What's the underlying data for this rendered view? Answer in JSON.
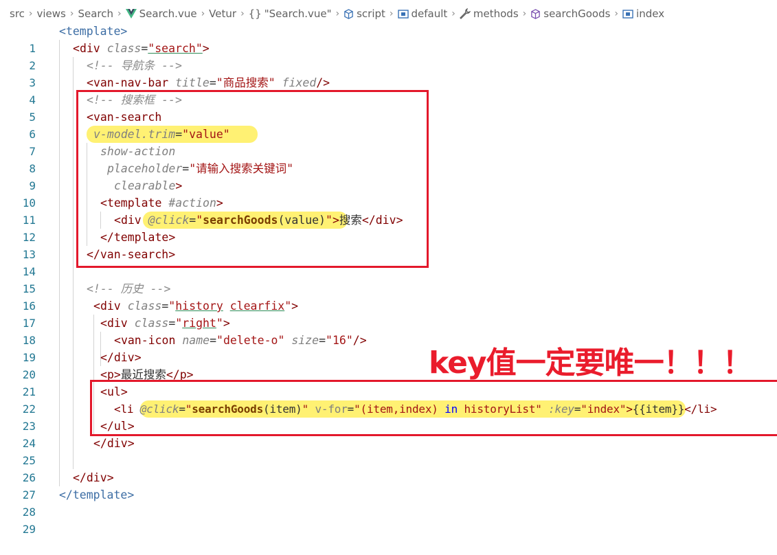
{
  "breadcrumb": [
    {
      "label": "src",
      "icon": ""
    },
    {
      "label": "views",
      "icon": ""
    },
    {
      "label": "Search",
      "icon": ""
    },
    {
      "label": "Search.vue",
      "icon": "vue-logo-icon"
    },
    {
      "label": "Vetur",
      "icon": ""
    },
    {
      "label": "\"Search.vue\"",
      "icon": "braces-icon"
    },
    {
      "label": "script",
      "icon": "cube-icon"
    },
    {
      "label": "default",
      "icon": "variable-icon"
    },
    {
      "label": "methods",
      "icon": "wrench-icon"
    },
    {
      "label": "searchGoods",
      "icon": "cube-icon"
    },
    {
      "label": "index",
      "icon": "variable-icon"
    }
  ],
  "line_numbers": [
    "1",
    "2",
    "3",
    "4",
    "5",
    "6",
    "7",
    "8",
    "9",
    "10",
    "11",
    "12",
    "13",
    "14",
    "15",
    "16",
    "17",
    "18",
    "19",
    "20",
    "21",
    "22",
    "23",
    "24",
    "25",
    "26",
    "27",
    "28",
    "29"
  ],
  "code": {
    "l1": {
      "open": "<",
      "tag": "template",
      "close": ">"
    },
    "l2": {
      "open": "<",
      "tag": "div",
      "attr": "class",
      "eq": "=",
      "val": "\"search\"",
      "close": ">"
    },
    "l3": {
      "comment": "<!-- 导航条 -->"
    },
    "l4": {
      "open": "<",
      "tag": "van-nav-bar",
      "attr": "title",
      "eq": "=",
      "val": "\"商品搜索\"",
      "attr2": "fixed",
      "close": "/>"
    },
    "l5": {
      "comment": "<!-- 搜索框 -->"
    },
    "l6": {
      "open": "<",
      "tag": "van-search"
    },
    "l7": {
      "attr": "v-model.trim",
      "eq": "=",
      "val": "\"value\""
    },
    "l8": {
      "attr": "show-action"
    },
    "l9": {
      "attr": "placeholder",
      "eq": "=",
      "val": "\"请输入搜索关键词\""
    },
    "l10": {
      "attr": "clearable",
      "close": ">"
    },
    "l11": {
      "open": "<",
      "tag": "template",
      "attr": "#action",
      "close": ">"
    },
    "l12": {
      "open": "<",
      "tag": "div",
      "attr": "@click",
      "eq": "=",
      "q1": "\"",
      "fn": "searchGoods",
      "args": "(value)",
      "q2": "\"",
      "close": ">",
      "text": "搜索",
      "endopen": "</",
      "endtag": "div",
      "endclose": ">"
    },
    "l13": {
      "open": "</",
      "tag": "template",
      "close": ">"
    },
    "l14": {
      "open": "</",
      "tag": "van-search",
      "close": ">"
    },
    "l16": {
      "comment": "<!-- 历史 -->"
    },
    "l17": {
      "open": "<",
      "tag": "div",
      "attr": "class",
      "eq": "=",
      "q1": "\"",
      "cls1": "history",
      "cls2": "clearfix",
      "q2": "\"",
      "close": ">"
    },
    "l18": {
      "open": "<",
      "tag": "div",
      "attr": "class",
      "eq": "=",
      "q1": "\"",
      "cls1": "right",
      "q2": "\"",
      "close": ">"
    },
    "l19": {
      "open": "<",
      "tag": "van-icon",
      "attr": "name",
      "eq": "=",
      "val": "\"delete-o\"",
      "attr2": "size",
      "eq2": "=",
      "val2": "\"16\"",
      "close": "/>"
    },
    "l20": {
      "open": "</",
      "tag": "div",
      "close": ">"
    },
    "l21": {
      "open": "<",
      "tag": "p",
      "close": ">",
      "text": "最近搜索",
      "endopen": "</",
      "endtag": "p",
      "endclose": ">"
    },
    "l22": {
      "open": "<",
      "tag": "ul",
      "close": ">"
    },
    "l23": {
      "open": "<",
      "tag": "li",
      "attr": "@click",
      "eq": "=",
      "q1": "\"",
      "fn": "searchGoods",
      "args": "(item)",
      "q2": "\"",
      "attr2": "v-for",
      "eq2": "=",
      "q3": "\"(item,index)",
      "kw": "in",
      "q4": "historyList\"",
      "attr3": ":key",
      "eq3": "=",
      "val3": "\"index\"",
      "close": ">",
      "mustache": "{{item}}",
      "endopen": "</",
      "endtag": "li",
      "endclose": ">"
    },
    "l24": {
      "open": "</",
      "tag": "ul",
      "close": ">"
    },
    "l25": {
      "open": "</",
      "tag": "div",
      "close": ">"
    },
    "l27": {
      "open": "</",
      "tag": "div",
      "close": ">"
    },
    "l28": {
      "open": "</",
      "tag": "template",
      "close": ">"
    }
  },
  "annotation": {
    "text": "key值一定要唯一！！！",
    "color": "#ea1c2c",
    "box_color": "#e3182b",
    "highlight_color": "#fff06b"
  }
}
